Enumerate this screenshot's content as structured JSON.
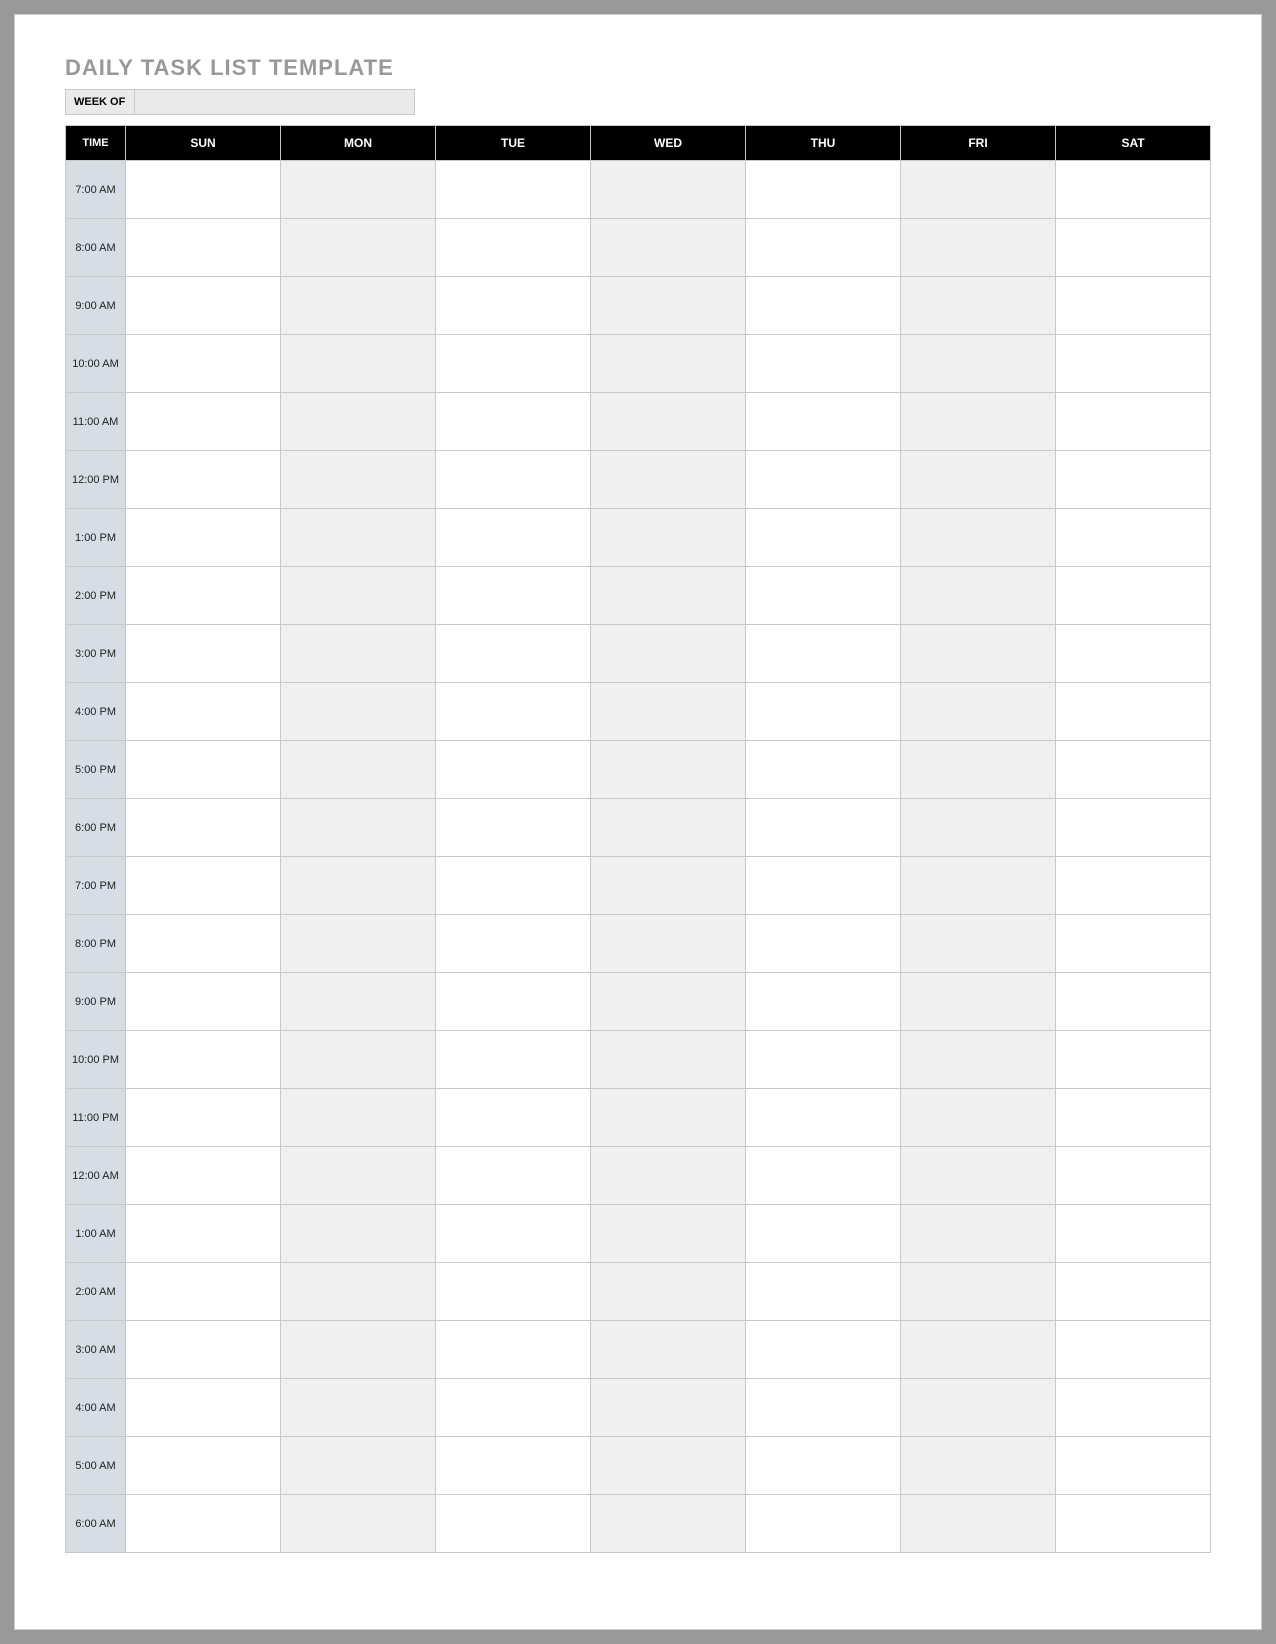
{
  "title": "DAILY TASK LIST TEMPLATE",
  "week_of_label": "WEEK OF",
  "week_of_value": "",
  "headers": {
    "time": "TIME",
    "days": [
      "SUN",
      "MON",
      "TUE",
      "WED",
      "THU",
      "FRI",
      "SAT"
    ]
  },
  "day_alt": [
    false,
    true,
    false,
    true,
    false,
    true,
    false
  ],
  "time_slots": [
    "7:00 AM",
    "8:00 AM",
    "9:00 AM",
    "10:00 AM",
    "11:00 AM",
    "12:00 PM",
    "1:00 PM",
    "2:00 PM",
    "3:00 PM",
    "4:00 PM",
    "5:00 PM",
    "6:00 PM",
    "7:00 PM",
    "8:00 PM",
    "9:00 PM",
    "10:00 PM",
    "11:00 PM",
    "12:00 AM",
    "1:00 AM",
    "2:00 AM",
    "3:00 AM",
    "4:00 AM",
    "5:00 AM",
    "6:00 AM"
  ]
}
